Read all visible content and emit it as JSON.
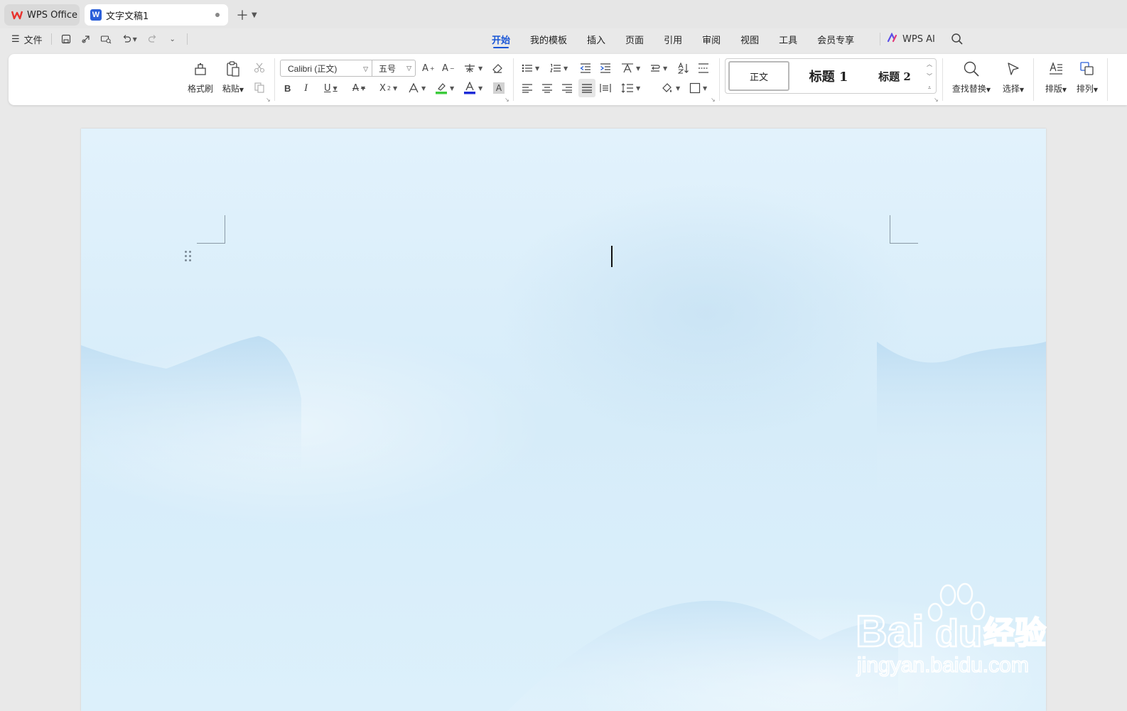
{
  "tabs": {
    "home": {
      "label": "WPS Office"
    },
    "doc": {
      "label": "文字文稿1"
    }
  },
  "menubar": {
    "file_label": "文件",
    "menus": [
      "开始",
      "我的模板",
      "插入",
      "页面",
      "引用",
      "审阅",
      "视图",
      "工具",
      "会员专享"
    ],
    "active_menu": "开始",
    "ai_label": "WPS AI"
  },
  "ribbon": {
    "format_painter": "格式刷",
    "paste": "粘贴",
    "font_name": "Calibri (正文)",
    "font_size": "五号",
    "styles": {
      "normal": "正文",
      "heading1": "标题 1",
      "heading2": "标题 2"
    },
    "find_replace": "查找替换",
    "select": "选择",
    "layout": "排版",
    "arrange": "排列"
  },
  "watermark": {
    "brand": "Bai",
    "brand2": "du",
    "cn": "经验",
    "url": "jingyan.baidu.com"
  },
  "colors": {
    "accent": "#1a56d6",
    "wps_red": "#e8322d",
    "highlight_green": "#3ccb3c",
    "font_blue": "#1d2bd6"
  }
}
